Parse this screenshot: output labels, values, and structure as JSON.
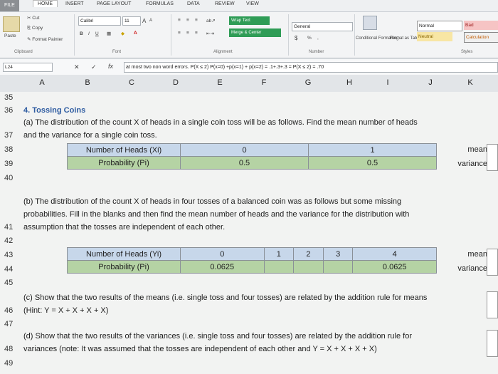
{
  "ribbon_tabs": [
    "FILE",
    "HOME",
    "INSERT",
    "PAGE LAYOUT",
    "FORMULAS",
    "DATA",
    "REVIEW",
    "VIEW"
  ],
  "clipboard": {
    "paste": "Paste",
    "cut": "Cut",
    "copy": "Copy",
    "format_painter": "Format Painter",
    "label": "Clipboard"
  },
  "font": {
    "name": "Calibri",
    "size": "11",
    "bold": "B",
    "italic": "I",
    "underline": "U",
    "grow": "A",
    "shrink": "A",
    "label": "Font"
  },
  "alignment": {
    "wrap": "Wrap Text",
    "merge": "Merge & Center",
    "label": "Alignment"
  },
  "number": {
    "format": "General",
    "currency": "$",
    "percent": "%",
    "comma": ",",
    "label": "Number"
  },
  "styles": {
    "conditional": "Conditional Formatting",
    "format_table": "Format as Table",
    "normal": "Normal",
    "bad": "Bad",
    "neutral": "Neutral",
    "calculation": "Calculation",
    "label": "Styles"
  },
  "formula_bar": {
    "name_box": "L24",
    "cancel": "✕",
    "enter": "✓",
    "fx": "fx",
    "content": "at most two non word errors. P(X ≤ 2) P(x=0) +p(x=1) + p(x=2) = .1+.3+.3 = P(X ≤ 2) = .70"
  },
  "columns": [
    "A",
    "B",
    "C",
    "D",
    "E",
    "F",
    "G",
    "H",
    "I",
    "J",
    "K"
  ],
  "rows": [
    "35",
    "36",
    "37",
    "38",
    "39",
    "40",
    "41",
    "42",
    "43",
    "44",
    "45",
    "46",
    "47",
    "48",
    "49"
  ],
  "sheet": {
    "title": "4. Tossing Coins",
    "a_line1": "(a) The distribution of the count X of heads in a single coin toss will be as follows. Find the mean number of heads",
    "a_line2": "and the variance for a single coin toss.",
    "t1_head": [
      "Number of Heads (Xi)",
      "0",
      "1"
    ],
    "t1_prob": [
      "Probability (Pi)",
      "0.5",
      "0.5"
    ],
    "mean_label": "mean:",
    "variance_label": "variance:",
    "b_line1": "(b) The distribution of the count X of heads in four tosses of a balanced coin was as follows but some missing",
    "b_line2": "probabilities. Fill in the blanks and then find the mean number of heads and the variance for the distribution with",
    "b_line3": "assumption that the tosses are independent of each other.",
    "t2_head": [
      "Number of Heads (Yi)",
      "0",
      "1",
      "2",
      "3",
      "4"
    ],
    "t2_prob": [
      "Probability (Pi)",
      "0.0625",
      "",
      "",
      "",
      "0.0625"
    ],
    "c_line1": "(c) Show that the two results of the means (i.e. single toss and four tosses) are related by the addition rule for means",
    "c_line2": "(Hint: Y = X + X + X + X)",
    "d_line1": "(d) Show that the two results of the variances (i.e. single toss and four tosses) are related by the addition rule for",
    "d_line2": "variances (note: It was assumed that the tosses are independent of each other and Y = X + X + X + X)"
  }
}
